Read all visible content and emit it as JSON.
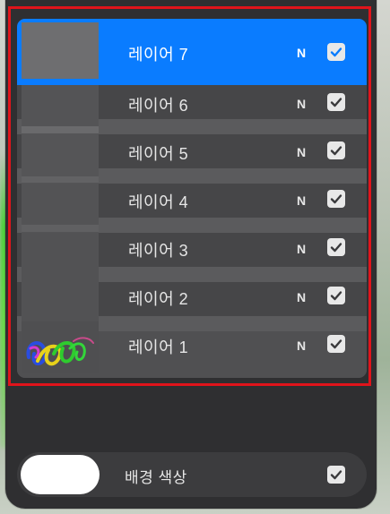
{
  "layers": [
    {
      "label": "레이어 7",
      "blend": "N",
      "visible": true,
      "selected": true
    },
    {
      "label": "레이어 6",
      "blend": "N",
      "visible": true,
      "selected": false
    },
    {
      "label": "레이어 5",
      "blend": "N",
      "visible": true,
      "selected": false
    },
    {
      "label": "레이어 4",
      "blend": "N",
      "visible": true,
      "selected": false
    },
    {
      "label": "레이어 3",
      "blend": "N",
      "visible": true,
      "selected": false
    },
    {
      "label": "레이어 2",
      "blend": "N",
      "visible": true,
      "selected": false
    },
    {
      "label": "레이어 1",
      "blend": "N",
      "visible": true,
      "selected": false
    }
  ],
  "background": {
    "label": "배경 색상",
    "color": "#ffffff",
    "visible": true
  },
  "colors": {
    "selection": "#0a7cff",
    "highlight_border": "#e0141b",
    "panel": "#2f2f31"
  },
  "icons": {
    "checkbox": "checkmark-icon"
  }
}
